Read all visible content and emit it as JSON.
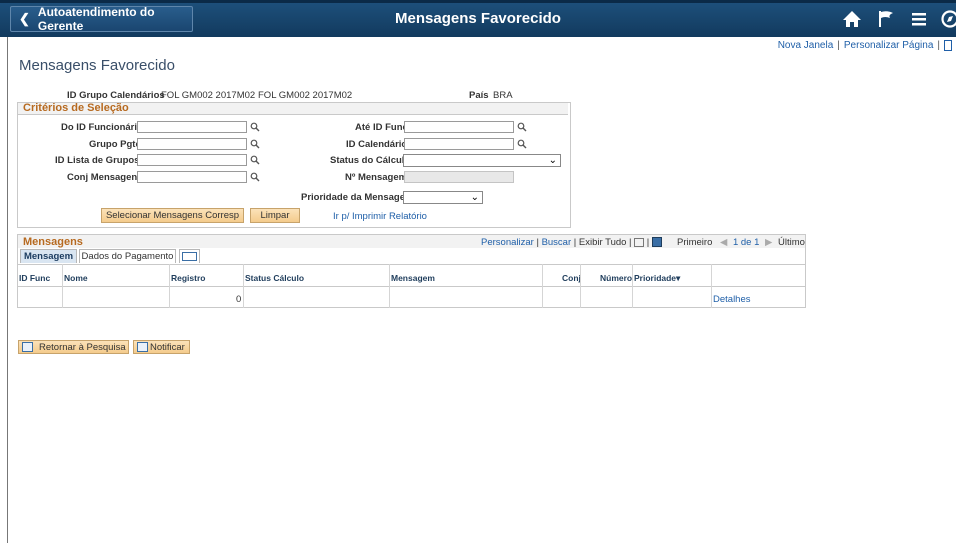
{
  "header": {
    "back_label": "Autoatendimento do Gerente",
    "title": "Mensagens Favorecido",
    "icons": [
      "home-icon",
      "flag-icon",
      "menu-icon",
      "navbar-compass-icon"
    ]
  },
  "top_links": {
    "new_window": "Nova Janela",
    "personalize_page": "Personalizar Página"
  },
  "page_title": "Mensagens Favorecido",
  "info": {
    "calendar_group_label": "ID Grupo Calendários",
    "calendar_group_code": "FOL GM002 2017M02",
    "calendar_group_desc": "FOL GM002 2017M02",
    "country_label": "País",
    "country_value": "BRA"
  },
  "criteria": {
    "title": "Critérios de Seleção",
    "from_employee_label": "Do ID Funcionário",
    "to_employee_label": "Até ID Func",
    "pay_group_label": "Grupo Pgto",
    "calendar_id_label": "ID Calendário",
    "group_list_label": "ID Lista de Grupos",
    "calc_status_label": "Status do Cálculo",
    "message_set_label": "Conj Mensagens",
    "message_number_label": "Nº Mensagem",
    "message_priority_label": "Prioridade da Mensagem",
    "select_button": "Selecionar Mensagens Corresp",
    "clear_button": "Limpar",
    "report_link": "Ir p/ Imprimir Relatório"
  },
  "grid": {
    "title": "Mensagens",
    "personalize": "Personalizar",
    "search": "Buscar",
    "view_all": "Exibir Tudo",
    "first": "Primeiro",
    "range": "1 de 1",
    "last": "Último",
    "tabs": [
      "Mensagem",
      "Dados do Pagamento"
    ],
    "columns": [
      "ID Func",
      "Nome",
      "Registro",
      "Status Cálculo",
      "Mensagem",
      "Conj",
      "Número",
      "Prioridade"
    ],
    "rows": [
      {
        "id_func": "",
        "nome": "",
        "registro": "0",
        "status": "",
        "mensagem": "",
        "conj": "",
        "numero": "",
        "prioridade": "",
        "link": "Detalhes"
      }
    ]
  },
  "footer": {
    "return_button": "Retornar à Pesquisa",
    "notify_button": "Notificar"
  },
  "colors": {
    "header_bg": "#1a4670",
    "section_title": "#b76a20",
    "link": "#1f5fa8",
    "button_bg": "#f4cb8c"
  }
}
